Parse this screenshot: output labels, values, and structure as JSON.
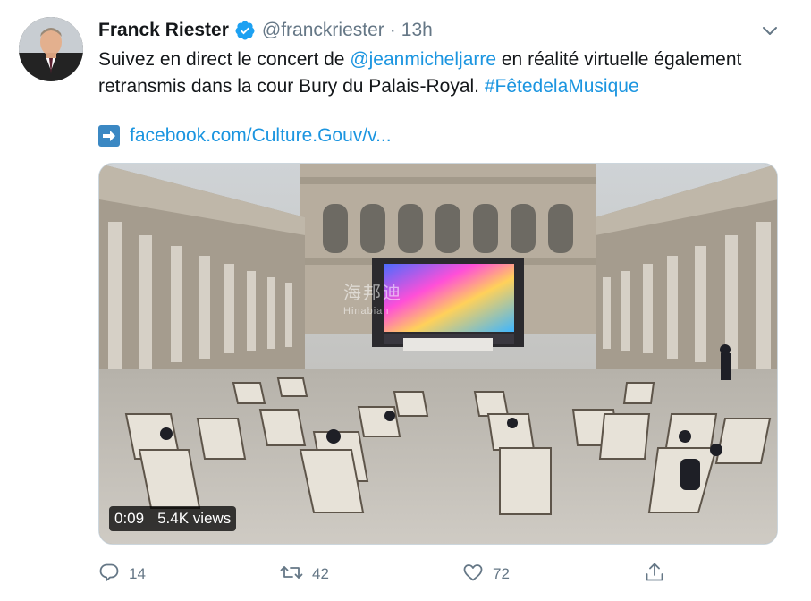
{
  "tweet": {
    "author_name": "Franck Riester",
    "handle": "@franckriester",
    "separator": "·",
    "time": "13h",
    "verified": true,
    "text": {
      "part1": "Suivez en direct le concert de ",
      "mention": "@jeanmicheljarre",
      "part2": " en réalité virtuelle également retransmis dans la cour Bury du Palais-Royal. ",
      "hashtag": "#FêtedelaMusique"
    },
    "link_text": "facebook.com/Culture.Gouv/v...",
    "media": {
      "type": "video",
      "duration": "0:09",
      "views": "5.4K views",
      "watermark_line1": "海邦迪",
      "watermark_line2": "Hinabian"
    },
    "actions": {
      "reply_count": "14",
      "retweet_count": "42",
      "like_count": "72"
    }
  },
  "icons": {
    "verified": "verified-badge-icon",
    "chevron": "chevron-down-icon",
    "arrow": "right-arrow-emoji-icon",
    "reply": "reply-icon",
    "retweet": "retweet-icon",
    "like": "heart-icon",
    "share": "share-icon"
  },
  "colors": {
    "link": "#1b95e0",
    "secondary": "#657786",
    "verified": "#1da1f2"
  }
}
